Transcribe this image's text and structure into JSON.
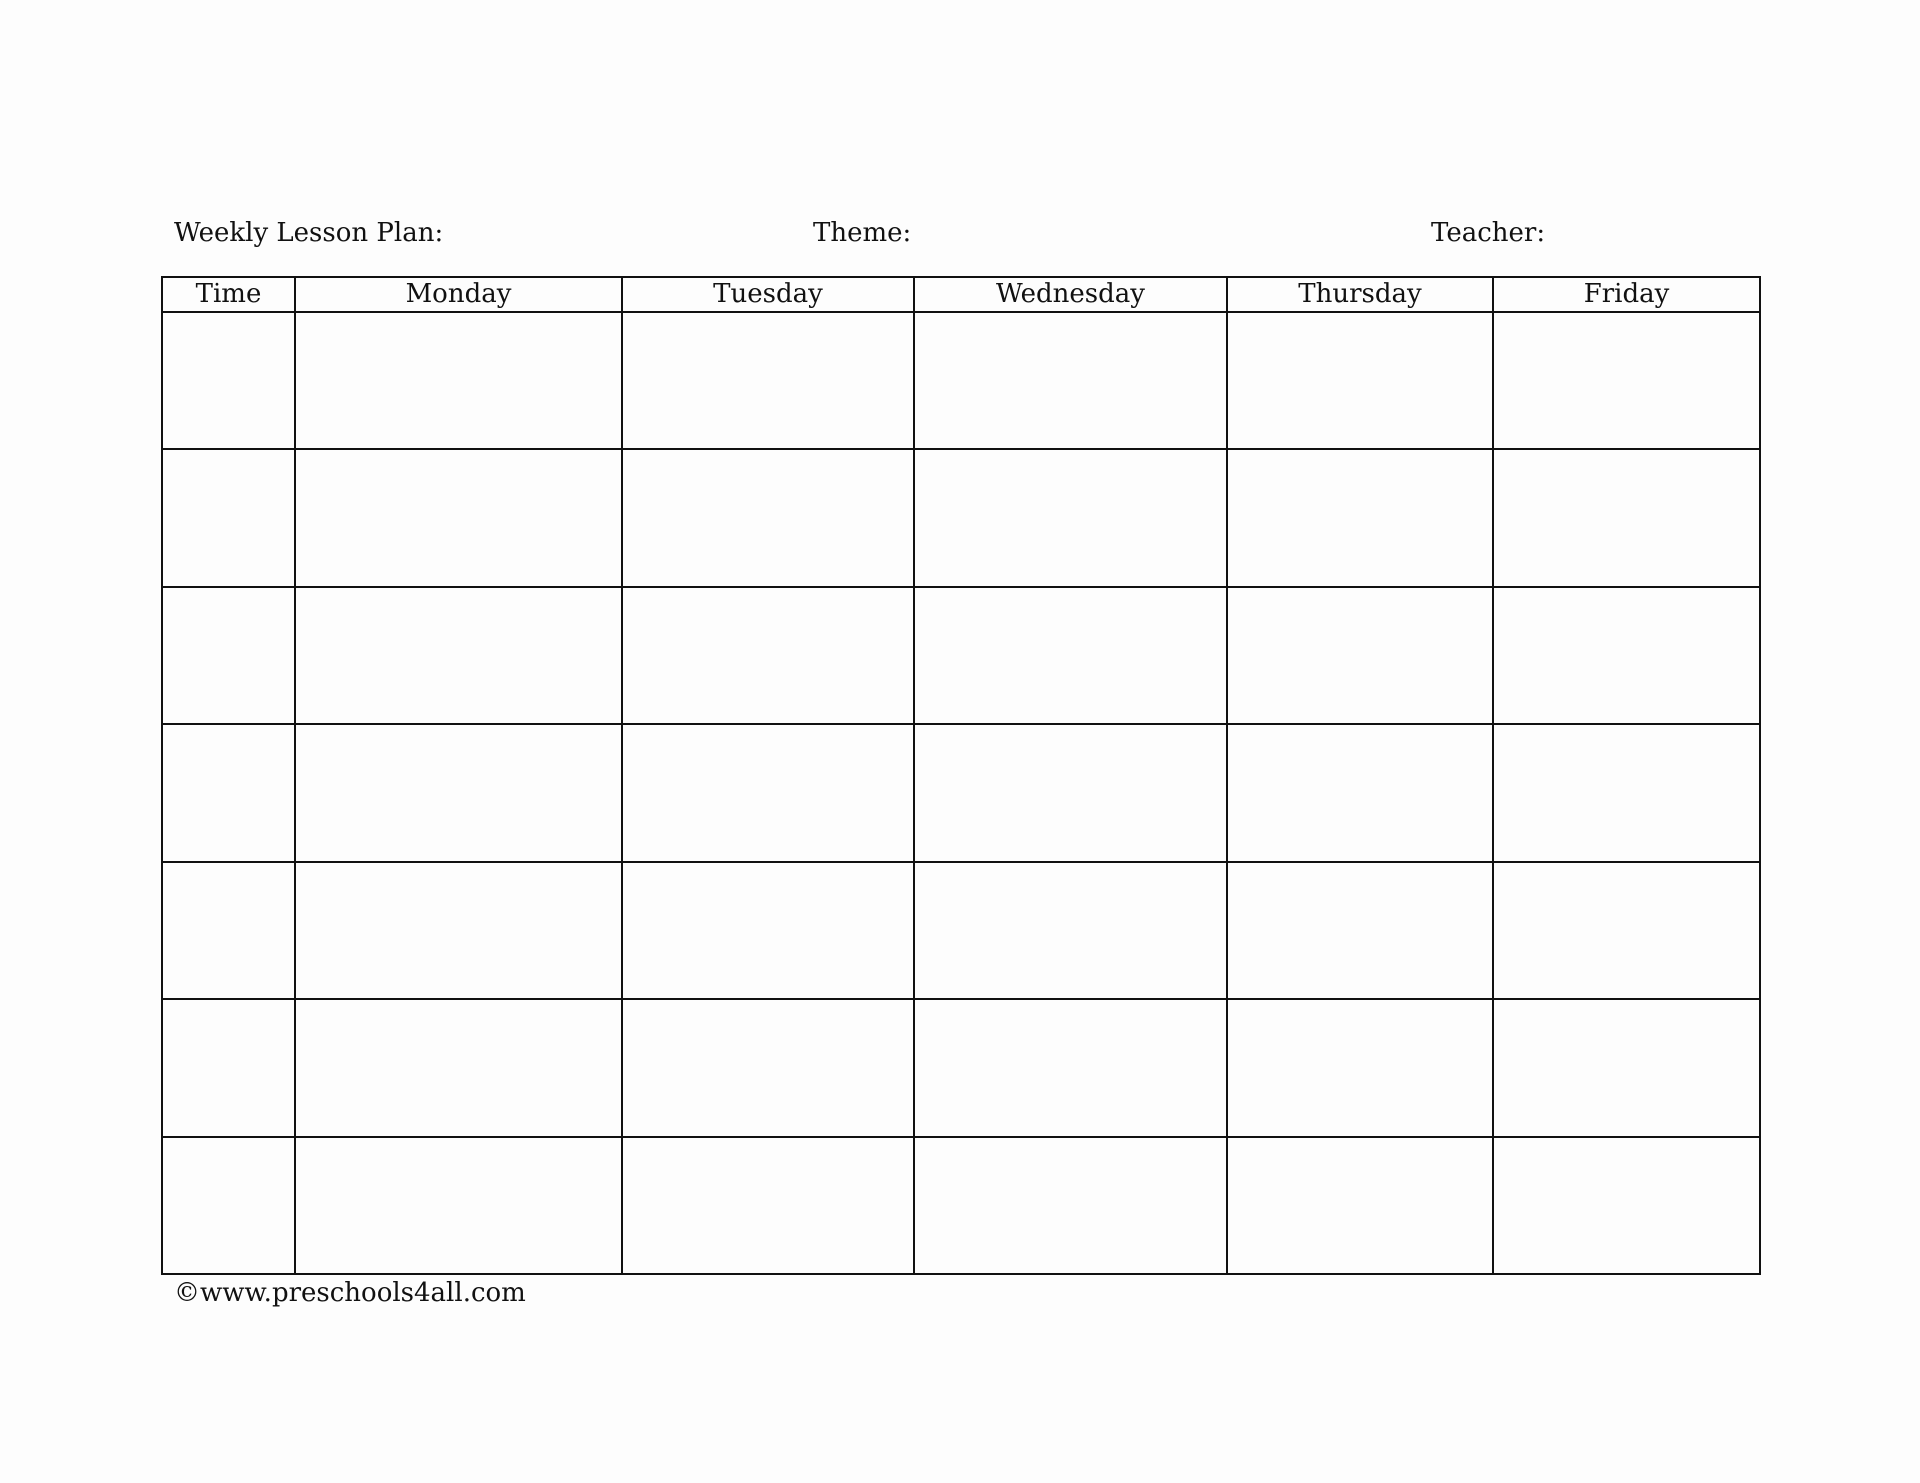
{
  "header": {
    "title": "Weekly Lesson Plan:",
    "theme": "Theme:",
    "teacher": "Teacher:"
  },
  "table": {
    "columns": [
      "Time",
      "Monday",
      "Tuesday",
      "Wednesday",
      "Thursday",
      "Friday"
    ],
    "row_count": 7,
    "rows": [
      [
        "",
        "",
        "",
        "",
        "",
        ""
      ],
      [
        "",
        "",
        "",
        "",
        "",
        ""
      ],
      [
        "",
        "",
        "",
        "",
        "",
        ""
      ],
      [
        "",
        "",
        "",
        "",
        "",
        ""
      ],
      [
        "",
        "",
        "",
        "",
        "",
        ""
      ],
      [
        "",
        "",
        "",
        "",
        "",
        ""
      ],
      [
        "",
        "",
        "",
        "",
        "",
        ""
      ]
    ]
  },
  "footer": {
    "copyright": "©www.preschools4all.com"
  }
}
